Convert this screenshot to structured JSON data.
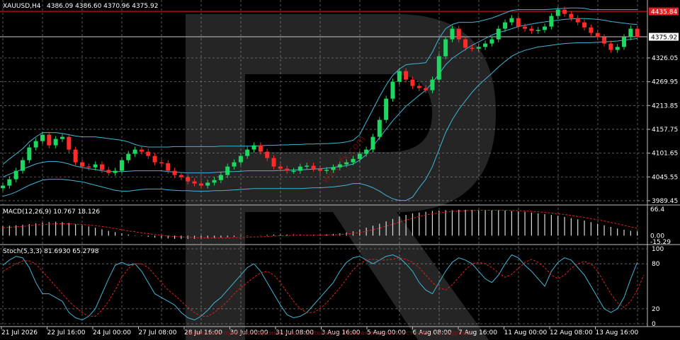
{
  "chart_data": [
    {
      "type": "candlestick",
      "symbol_label": "XAUUSD,H4",
      "ohlc_label": "4386.09 4386.60 4370.96 4375.92",
      "current_price_label": "4375.92",
      "resistance_label": "4435.84",
      "resistance": 4435.84,
      "yticks": [
        "4326.05",
        "4269.95",
        "4213.85",
        "4157.75",
        "4101.65",
        "4045.55",
        "3989.45"
      ],
      "ylim": [
        3986,
        4456
      ],
      "xtick_labels": [
        "21 Jul 2026",
        "22 Jul 16:00",
        "24 Jul 00:00",
        "27 Jul 08:00",
        "28 Jul 16:00",
        "30 Jul 00:00",
        "31 Jul 08:00",
        "3 Aug 16:00",
        "5 Aug 00:00",
        "6 Aug 08:00",
        "7 Aug 16:00",
        "11 Aug 00:00",
        "12 Aug 08:00",
        "13 Aug 16:00"
      ],
      "close": [
        4025,
        4040,
        4060,
        4085,
        4115,
        4130,
        4145,
        4120,
        4135,
        4140,
        4110,
        4080,
        4070,
        4068,
        4075,
        4062,
        4055,
        4060,
        4085,
        4100,
        4110,
        4105,
        4095,
        4080,
        4078,
        4060,
        4050,
        4045,
        4035,
        4030,
        4025,
        4032,
        4038,
        4050,
        4070,
        4080,
        4095,
        4110,
        4120,
        4105,
        4090,
        4070,
        4065,
        4060,
        4060,
        4070,
        4072,
        4065,
        4060,
        4062,
        4068,
        4075,
        4080,
        4088,
        4100,
        4110,
        4140,
        4180,
        4230,
        4270,
        4295,
        4275,
        4260,
        4255,
        4250,
        4275,
        4330,
        4370,
        4395,
        4370,
        4350,
        4348,
        4352,
        4360,
        4370,
        4395,
        4410,
        4420,
        4400,
        4395,
        4390,
        4392,
        4400,
        4425,
        4440,
        4430,
        4420,
        4410,
        4398,
        4385,
        4375,
        4360,
        4345,
        4352,
        4375,
        4395,
        4375
      ],
      "upper_band": [
        4075,
        4088,
        4100,
        4112,
        4128,
        4140,
        4150,
        4150,
        4150,
        4148,
        4145,
        4142,
        4140,
        4140,
        4140,
        4138,
        4136,
        4134,
        4132,
        4128,
        4122,
        4118,
        4116,
        4116,
        4116,
        4116,
        4117,
        4117,
        4117,
        4117,
        4117,
        4117,
        4117,
        4118,
        4118,
        4118,
        4118,
        4118,
        4118,
        4119,
        4120,
        4120,
        4121,
        4121,
        4122,
        4122,
        4123,
        4123,
        4124,
        4124,
        4125,
        4126,
        4128,
        4132,
        4145,
        4175,
        4205,
        4235,
        4262,
        4285,
        4300,
        4310,
        4312,
        4313,
        4315,
        4340,
        4372,
        4395,
        4405,
        4410,
        4410,
        4410,
        4412,
        4416,
        4420,
        4426,
        4432,
        4438,
        4440,
        4440,
        4440,
        4440,
        4440,
        4441,
        4442,
        4443,
        4444,
        4444,
        4443,
        4440,
        4440,
        4440,
        4440,
        4440,
        4440,
        4440,
        4440
      ],
      "middle_band": [
        4045,
        4052,
        4058,
        4064,
        4070,
        4076,
        4080,
        4082,
        4082,
        4080,
        4076,
        4071,
        4068,
        4065,
        4063,
        4060,
        4058,
        4058,
        4058,
        4059,
        4060,
        4060,
        4060,
        4060,
        4060,
        4058,
        4057,
        4056,
        4055,
        4055,
        4055,
        4055,
        4056,
        4057,
        4058,
        4058,
        4059,
        4060,
        4060,
        4060,
        4060,
        4060,
        4061,
        4061,
        4062,
        4062,
        4063,
        4064,
        4065,
        4066,
        4068,
        4070,
        4072,
        4076,
        4085,
        4098,
        4118,
        4138,
        4158,
        4178,
        4195,
        4212,
        4225,
        4238,
        4250,
        4268,
        4288,
        4310,
        4325,
        4336,
        4346,
        4356,
        4364,
        4372,
        4380,
        4386,
        4390,
        4395,
        4400,
        4403,
        4406,
        4409,
        4411,
        4413,
        4415,
        4417,
        4418,
        4419,
        4419,
        4418,
        4417,
        4415,
        4412,
        4410,
        4408,
        4406,
        4405
      ],
      "lower_band": [
        4000,
        4004,
        4010,
        4018,
        4026,
        4032,
        4038,
        4040,
        4040,
        4040,
        4038,
        4036,
        4034,
        4030,
        4026,
        4022,
        4018,
        4014,
        4012,
        4012,
        4014,
        4016,
        4017,
        4017,
        4017,
        4015,
        4014,
        4013,
        4013,
        4012,
        4012,
        4012,
        4013,
        4013,
        4014,
        4015,
        4016,
        4017,
        4018,
        4018,
        4018,
        4018,
        4018,
        4018,
        4018,
        4018,
        4019,
        4020,
        4020,
        4021,
        4022,
        4024,
        4026,
        4030,
        4030,
        4026,
        4020,
        4012,
        4002,
        3994,
        3990,
        3990,
        3998,
        4020,
        4040,
        4070,
        4110,
        4150,
        4180,
        4205,
        4225,
        4245,
        4262,
        4276,
        4290,
        4305,
        4318,
        4330,
        4338,
        4344,
        4348,
        4352,
        4354,
        4356,
        4358,
        4360,
        4361,
        4362,
        4362,
        4362,
        4363,
        4364,
        4365,
        4366,
        4368,
        4370,
        4372
      ]
    },
    {
      "type": "bar",
      "indicator_label": "MACD(12,26,9) 10.767 18.126",
      "yticks": [
        "66.4",
        "0.00",
        "-15.29"
      ],
      "ylim": [
        -15.29,
        66.4
      ],
      "histogram": [
        24,
        25,
        26,
        27,
        29,
        31,
        33,
        34,
        35,
        34,
        32,
        29,
        26,
        23,
        20,
        16,
        12,
        9,
        6,
        3,
        1,
        -1,
        -3,
        -5,
        -6,
        -7,
        -8,
        -8,
        -8,
        -8,
        -7,
        -7,
        -6,
        -5,
        -4,
        -3,
        -2,
        -1,
        0,
        1,
        2,
        3,
        3,
        3,
        3,
        3,
        2,
        2,
        2,
        3,
        4,
        6,
        8,
        11,
        15,
        20,
        25,
        30,
        36,
        42,
        48,
        52,
        56,
        58,
        60,
        62,
        63,
        64,
        64,
        65,
        65,
        65,
        64,
        64,
        64,
        64,
        63,
        62,
        61,
        60,
        58,
        56,
        54,
        52,
        50,
        47,
        44,
        41,
        38,
        34,
        30,
        26,
        22,
        18,
        15,
        12,
        11
      ],
      "signal": [
        20,
        21,
        22,
        23,
        25,
        27,
        28,
        29,
        30,
        30,
        30,
        29,
        28,
        27,
        25,
        23,
        21,
        18,
        15,
        12,
        10,
        7,
        5,
        3,
        1,
        -1,
        -2,
        -3,
        -4,
        -5,
        -5,
        -6,
        -6,
        -6,
        -6,
        -5,
        -5,
        -4,
        -3,
        -3,
        -2,
        -1,
        0,
        0,
        1,
        1,
        1,
        1,
        1,
        2,
        2,
        3,
        4,
        6,
        8,
        11,
        15,
        19,
        24,
        29,
        34,
        39,
        44,
        48,
        52,
        55,
        57,
        59,
        61,
        62,
        63,
        63,
        64,
        64,
        64,
        64,
        64,
        63,
        63,
        62,
        61,
        60,
        58,
        57,
        55,
        53,
        51,
        48,
        46,
        43,
        40,
        37,
        33,
        30,
        26,
        22,
        19
      ]
    },
    {
      "type": "line",
      "indicator_label": "Stoch(5,3,3) 81.6930 65.2798",
      "yticks": [
        "100",
        "80",
        "20",
        "0"
      ],
      "ylim": [
        0,
        100
      ],
      "main": [
        78,
        85,
        90,
        88,
        75,
        55,
        40,
        40,
        35,
        30,
        15,
        8,
        5,
        10,
        20,
        40,
        60,
        78,
        82,
        78,
        80,
        70,
        55,
        40,
        35,
        30,
        25,
        15,
        8,
        5,
        10,
        18,
        28,
        35,
        45,
        55,
        65,
        75,
        80,
        70,
        55,
        40,
        25,
        12,
        8,
        10,
        15,
        25,
        35,
        45,
        55,
        70,
        82,
        88,
        90,
        85,
        80,
        85,
        90,
        92,
        88,
        80,
        70,
        55,
        45,
        40,
        55,
        70,
        82,
        88,
        85,
        80,
        70,
        60,
        55,
        65,
        80,
        92,
        88,
        78,
        70,
        60,
        50,
        70,
        82,
        88,
        85,
        75,
        65,
        50,
        35,
        20,
        15,
        20,
        35,
        60,
        82
      ],
      "signal": [
        70,
        75,
        80,
        84,
        84,
        80,
        70,
        60,
        50,
        40,
        30,
        22,
        15,
        10,
        10,
        18,
        30,
        45,
        62,
        74,
        80,
        80,
        75,
        65,
        55,
        45,
        38,
        30,
        22,
        15,
        10,
        10,
        15,
        22,
        30,
        40,
        48,
        55,
        62,
        68,
        70,
        65,
        55,
        42,
        30,
        20,
        15,
        15,
        20,
        28,
        38,
        48,
        60,
        72,
        80,
        85,
        86,
        85,
        85,
        86,
        88,
        86,
        82,
        75,
        65,
        55,
        48,
        45,
        52,
        62,
        72,
        80,
        82,
        80,
        75,
        68,
        62,
        66,
        74,
        82,
        86,
        82,
        75,
        65,
        60,
        65,
        74,
        80,
        83,
        80,
        70,
        55,
        40,
        28,
        22,
        30,
        45,
        65
      ]
    }
  ],
  "watermark": {
    "url": "www.fx.com",
    "notice": "Защищено пробной версией Visual Watermark. Полная версия не ставит эту надпись."
  }
}
